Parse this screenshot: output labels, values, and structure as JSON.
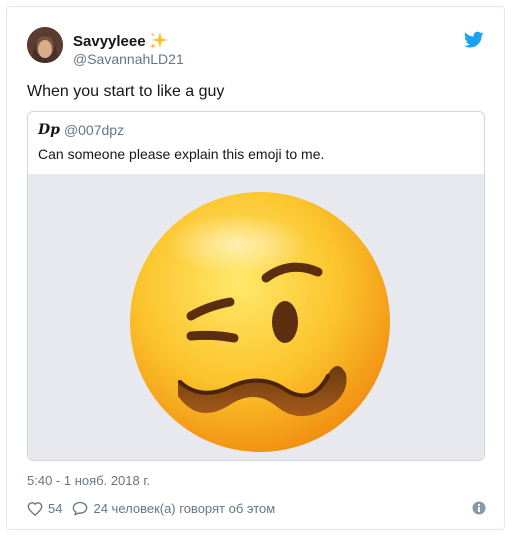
{
  "user": {
    "display_name": "Savyyleee",
    "handle": "@SavannahLD21"
  },
  "tweet": {
    "text": "When you start to like a guy"
  },
  "quoted": {
    "initials": "Dp",
    "handle": "@007dpz",
    "text": "Can someone please explain this emoji to me."
  },
  "meta": {
    "timestamp": "5:40 - 1 нояб. 2018 г.",
    "likes": "54",
    "talking": "24 человек(а) говорят об этом"
  },
  "icons": {
    "brand": "twitter-bird-icon",
    "like": "heart-icon",
    "reply": "speech-bubble-icon",
    "info": "info-icon",
    "sparkle": "sparkles-icon"
  },
  "colors": {
    "twitter_blue": "#1da1f2",
    "muted": "#657786",
    "border": "#e1e8ed"
  }
}
